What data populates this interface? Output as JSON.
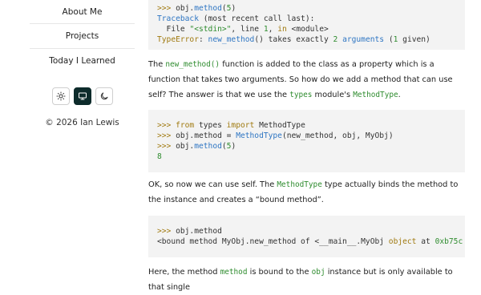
{
  "nav": {
    "items": [
      {
        "label": "About Me"
      },
      {
        "label": "Projects"
      },
      {
        "label": "Today I Learned"
      }
    ]
  },
  "theme": {
    "buttons": [
      {
        "icon": "sun-icon",
        "active": false
      },
      {
        "icon": "monitor-icon",
        "active": true
      },
      {
        "icon": "moon-icon",
        "active": false
      }
    ],
    "active_color": "#0d2b2b"
  },
  "footer": {
    "copyright": "© 2026 Ian Lewis"
  },
  "article": {
    "block1": {
      "l1_prompt": ">>> ",
      "l1_a": "obj.",
      "l1_b": "method",
      "l1_c": "(",
      "l1_d": "5",
      "l1_e": ")",
      "l2_a": "Traceback",
      "l2_b": " (most recent call last):",
      "l3_a": "  File ",
      "l3_b": "\"<stdin>\"",
      "l3_c": ", line ",
      "l3_d": "1",
      "l3_e": ", ",
      "l3_f": "in",
      "l3_g": " <module>",
      "l4_a": "TypeError",
      "l4_b": ": ",
      "l4_c": "new_method",
      "l4_d": "() takes exactly ",
      "l4_e": "2",
      "l4_f": " ",
      "l4_g": "arguments",
      "l4_h": " (",
      "l4_i": "1",
      "l4_j": " given)"
    },
    "para1": {
      "t1": "The ",
      "c1": "new_method()",
      "t2": " function is added to the class as a property which is a function that takes two arguments. So how do we add a method that can use self? The answer is that we use the ",
      "c2": "types",
      "t3": " module's ",
      "c3": "MethodType",
      "t4": "."
    },
    "block2": {
      "l1_prompt": ">>> ",
      "l1_a": "from",
      "l1_b": " types ",
      "l1_c": "import",
      "l1_d": " MethodType",
      "l2_prompt": ">>> ",
      "l2_a": "obj.method = ",
      "l2_b": "MethodType",
      "l2_c": "(new_method, obj, MyObj)",
      "l3_prompt": ">>> ",
      "l3_a": "obj.",
      "l3_b": "method",
      "l3_c": "(",
      "l3_d": "5",
      "l3_e": ")",
      "l4": "8"
    },
    "para2": {
      "t1": "OK, so now we can use self. The ",
      "c1": "MethodType",
      "t2": " type actually binds the method to the instance and creates a “bound method”."
    },
    "block3": {
      "l1_prompt": ">>> ",
      "l1_a": "obj.method",
      "l2_a": "<bound method MyObj.new_method of <__main__.MyObj ",
      "l2_b": "object",
      "l2_c": " at ",
      "l2_d": "0xb75c"
    },
    "para3": {
      "t1": "Here, the method ",
      "c1": "method",
      "t2": " is bound to the ",
      "c2": "obj",
      "t3": " instance but is only available to that single"
    }
  }
}
